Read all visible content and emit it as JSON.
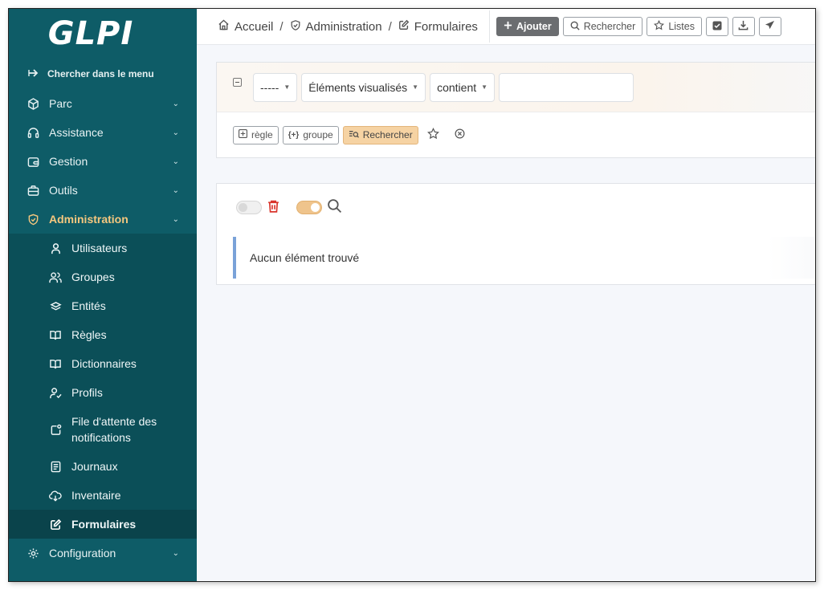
{
  "app": {
    "logo_text": "GLPI"
  },
  "sidebar": {
    "search_label": "Chercher dans le menu",
    "items": [
      {
        "label": "Parc",
        "icon": "box-icon"
      },
      {
        "label": "Assistance",
        "icon": "headset-icon"
      },
      {
        "label": "Gestion",
        "icon": "wallet-icon"
      },
      {
        "label": "Outils",
        "icon": "briefcase-icon"
      },
      {
        "label": "Administration",
        "icon": "shield-check-icon",
        "active": true
      },
      {
        "label": "Configuration",
        "icon": "gear-icon"
      }
    ],
    "submenu": [
      {
        "label": "Utilisateurs",
        "icon": "user-icon"
      },
      {
        "label": "Groupes",
        "icon": "users-icon"
      },
      {
        "label": "Entités",
        "icon": "stack-icon"
      },
      {
        "label": "Règles",
        "icon": "book-icon"
      },
      {
        "label": "Dictionnaires",
        "icon": "book-icon"
      },
      {
        "label": "Profils",
        "icon": "user-check-icon"
      },
      {
        "label": "File d'attente des notifications",
        "icon": "notification-icon"
      },
      {
        "label": "Journaux",
        "icon": "log-icon"
      },
      {
        "label": "Inventaire",
        "icon": "cloud-download-icon"
      },
      {
        "label": "Formulaires",
        "icon": "edit-icon",
        "selected": true
      }
    ]
  },
  "breadcrumb": {
    "home": "Accueil",
    "section": "Administration",
    "page": "Formulaires"
  },
  "toolbar": {
    "add": "Ajouter",
    "search": "Rechercher",
    "lists": "Listes"
  },
  "criteria": {
    "field_select": "-----",
    "type_select": "Éléments visualisés",
    "operator_select": "contient",
    "value": ""
  },
  "criteria_actions": {
    "rule": "règle",
    "group": "groupe",
    "search": "Rechercher"
  },
  "results": {
    "empty_message": "Aucun élément trouvé"
  },
  "colors": {
    "sidebar_bg": "#0e5c67",
    "active_accent": "#f5c77e",
    "search_button": "#f6d3a3"
  }
}
